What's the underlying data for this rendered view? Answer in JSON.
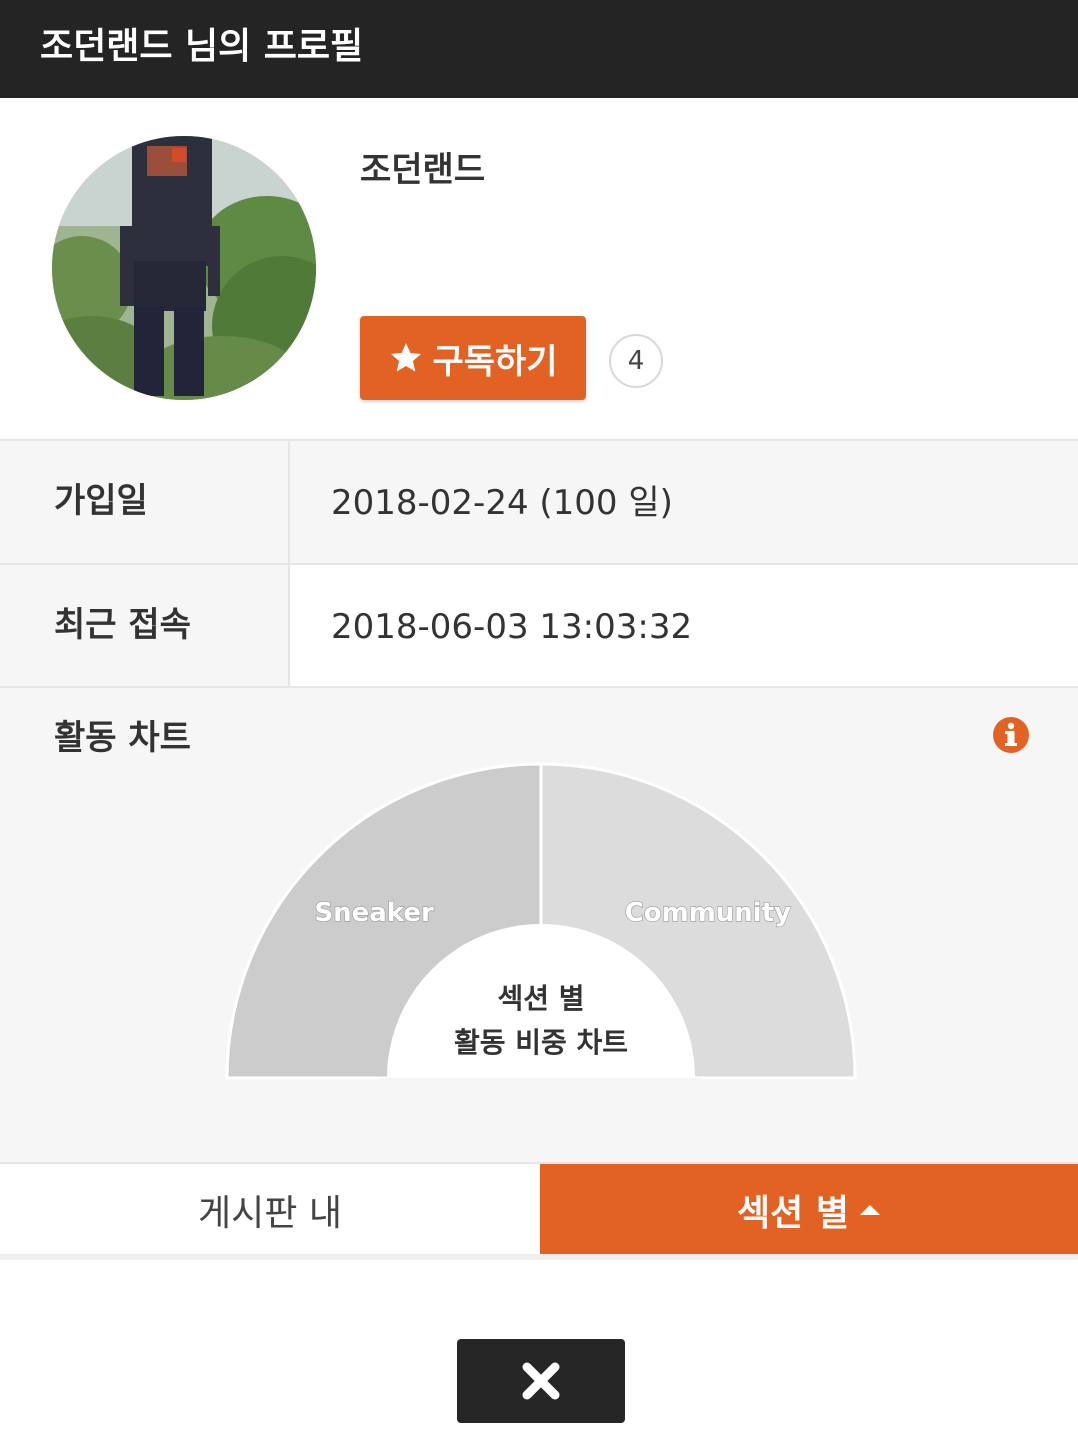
{
  "header": {
    "title": "조던랜드 님의 프로필"
  },
  "profile": {
    "nickname": "조던랜드",
    "subscribe_label": "구독하기",
    "subscriber_count": "4"
  },
  "info": {
    "join_label": "가입일",
    "join_value": "2018-02-24 (100 일)",
    "recent_label": "최근 접속",
    "recent_value": "2018-06-03 13:03:32"
  },
  "activity": {
    "title": "활동 차트",
    "center_line1": "섹션 별",
    "center_line2": "활동 비중 차트"
  },
  "chart_data": {
    "type": "pie",
    "categories": [
      "Sneaker",
      "Community"
    ],
    "values": [
      50,
      50
    ],
    "colors": [
      "#cccccc",
      "#dcdcdc"
    ]
  },
  "tabs": {
    "board": "게시판 내",
    "section": "섹션 별"
  },
  "icons": {
    "subscribe": "star-icon",
    "info": "info-icon",
    "tab_section": "caret-up-icon",
    "close": "close-icon"
  },
  "colors": {
    "accent": "#e26223",
    "header_bg": "#242424"
  }
}
